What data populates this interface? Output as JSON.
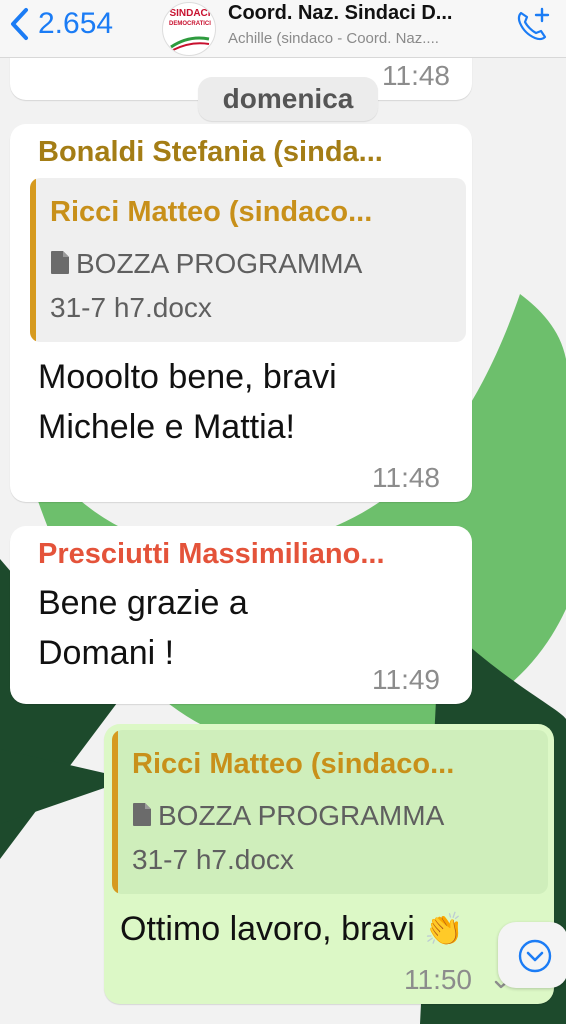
{
  "header": {
    "back_count": "2.654",
    "title": "Coord. Naz. Sindaci D...",
    "subtitle": "Achille (sindaco - Coord. Naz....",
    "avatar_logo": "SINDACI",
    "avatar_logo_sub": "DEMOCRATICI"
  },
  "colors": {
    "accent_blue": "#1b7cf5",
    "outgoing_bubble": "#dcf8c6",
    "wallpaper_green": "#6dbf6c",
    "wallpaper_dark": "#1d4a2c",
    "sender_bonaldi": "#a47d15",
    "sender_presciutti": "#e4533a",
    "quote_sender": "#c8901a"
  },
  "chat": {
    "prev_time": "11:48",
    "date_separator": "domenica",
    "messages": [
      {
        "sender": "Bonaldi Stefania (sinda...",
        "quote_sender": "Ricci Matteo (sindaco...",
        "quote_file_line1": "BOZZA PROGRAMMA",
        "quote_file_line2": "31-7 h7.docx",
        "text_line1": "Mooolto bene, bravi",
        "text_line2": "Michele e Mattia!",
        "time": "11:48"
      },
      {
        "sender": "Presciutti Massimiliano...",
        "text_line1": "Bene grazie a",
        "text_line2": "Domani !",
        "time": "11:49"
      },
      {
        "quote_sender": "Ricci Matteo (sindaco...",
        "quote_file_line1": "BOZZA PROGRAMMA",
        "quote_file_line2": "31-7 h7.docx",
        "text": "Ottimo lavoro, bravi",
        "emoji": "👏",
        "time": "11:50"
      }
    ]
  },
  "icons": [
    "chevron-left-icon",
    "phone-plus-icon",
    "document-icon",
    "clapping-hands-icon",
    "chevron-down-icon",
    "delivered-check-icon"
  ]
}
